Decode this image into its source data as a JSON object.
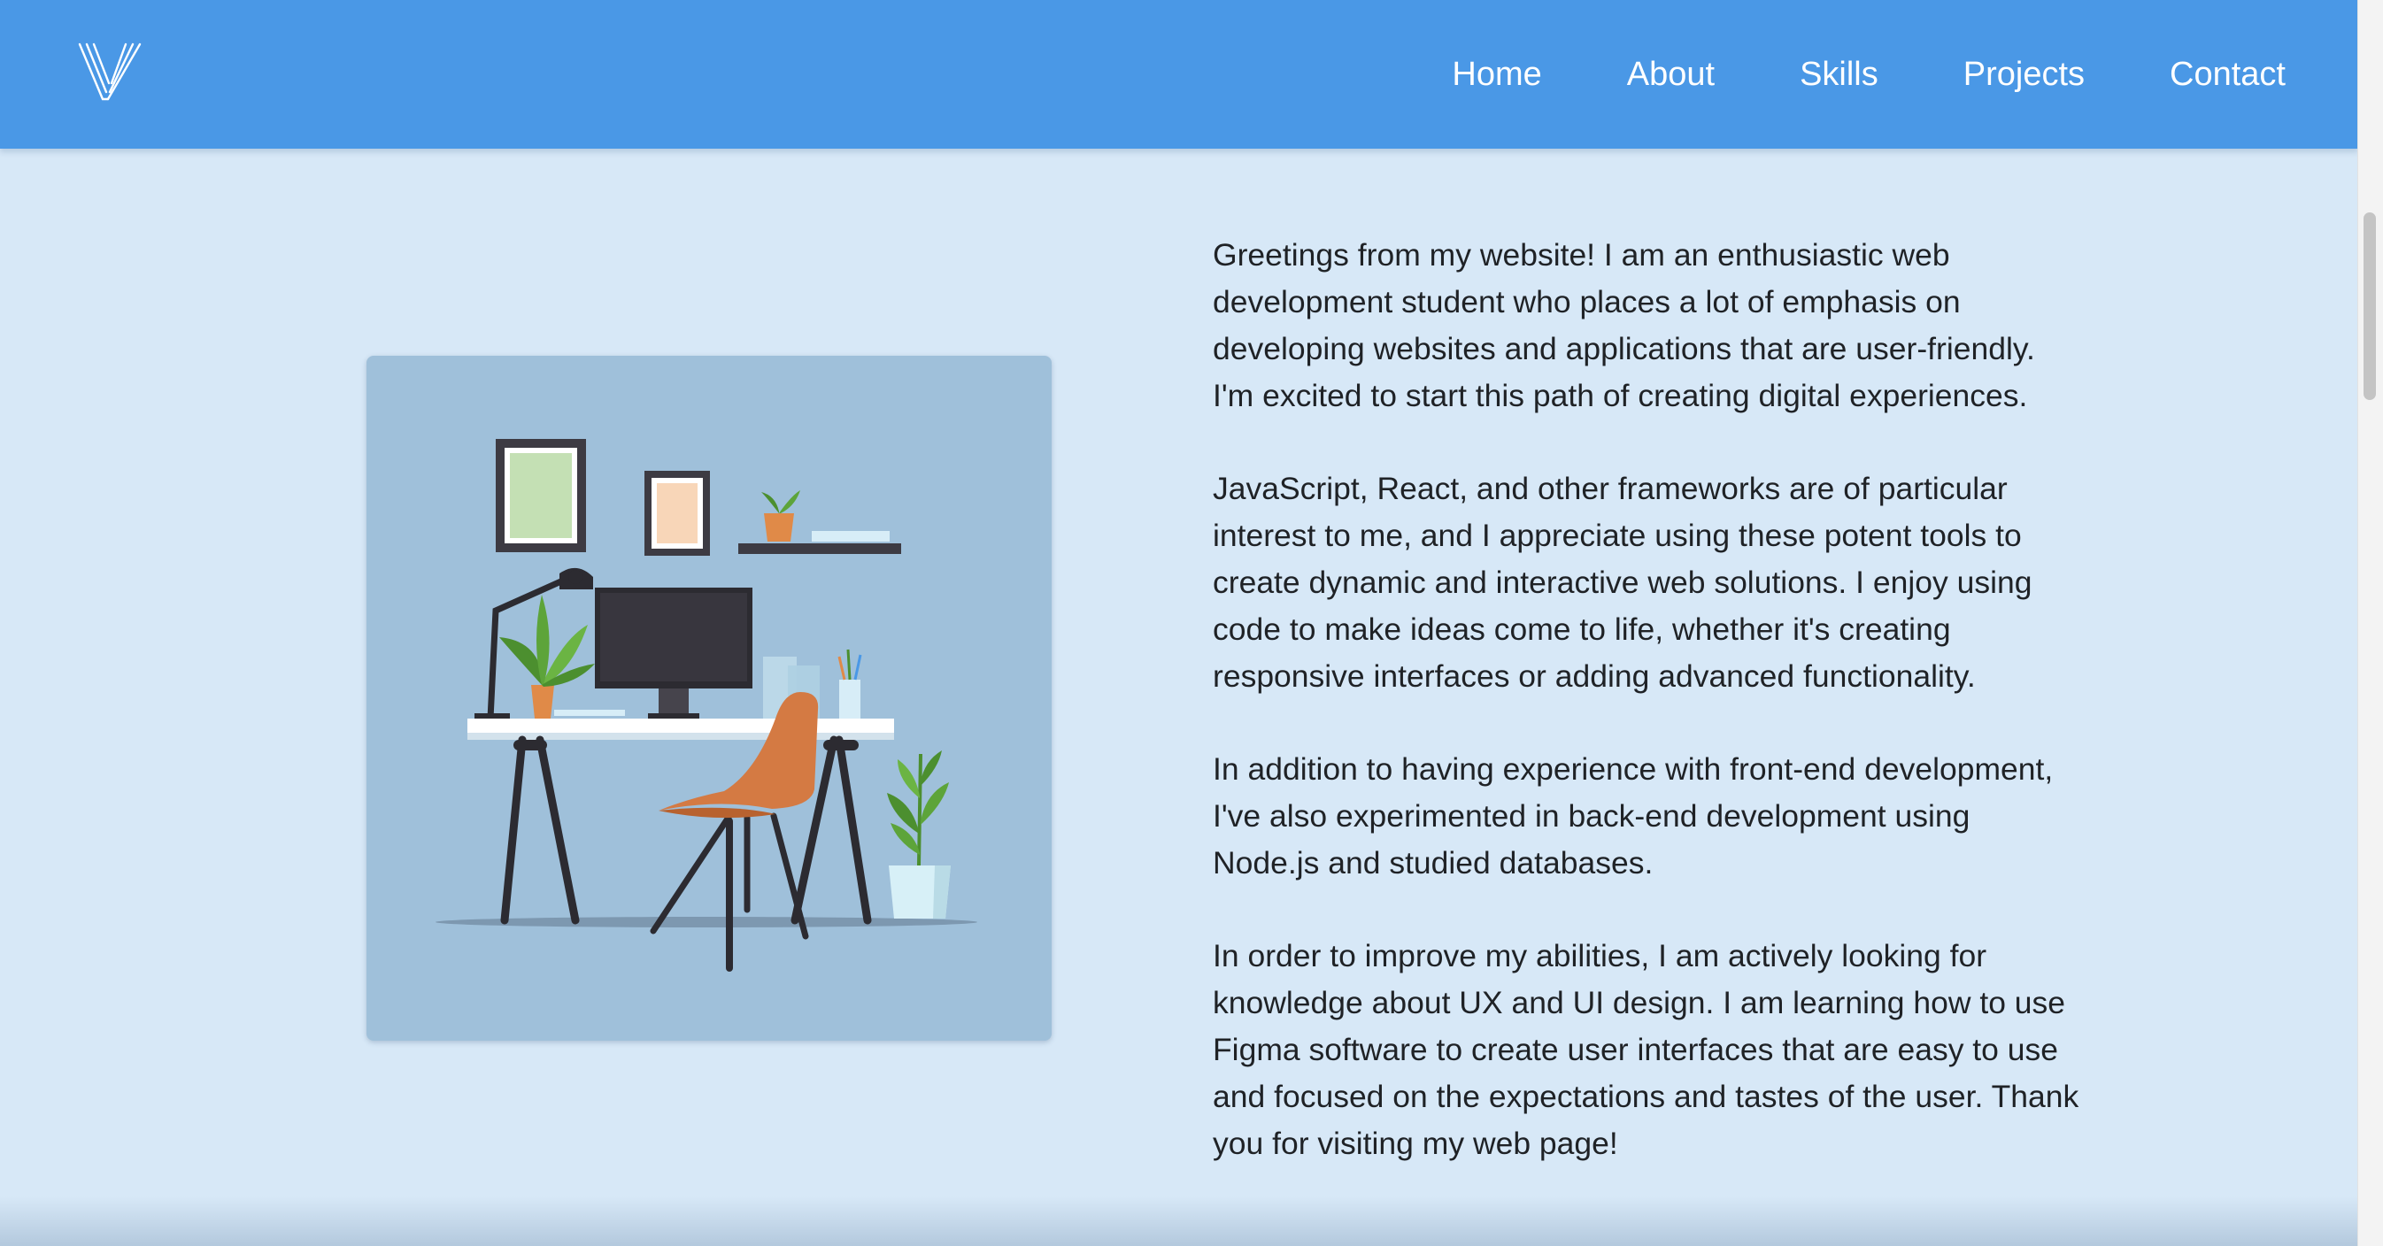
{
  "header": {
    "logo_icon": "stylized-v-logo",
    "brand_color": "#4a98e6",
    "nav": [
      {
        "label": "Home"
      },
      {
        "label": "About"
      },
      {
        "label": "Skills"
      },
      {
        "label": "Projects"
      },
      {
        "label": "Contact"
      }
    ]
  },
  "about": {
    "illustration": "workspace-desk-illustration",
    "paragraphs": [
      "Greetings from my website! I am an enthusiastic web development student who places a lot of emphasis on developing websites and applications that are user-friendly. I'm excited to start this path of creating digital experiences.",
      "JavaScript, React, and other frameworks are of particular interest to me, and I appreciate using these potent tools to create dynamic and interactive web solutions. I enjoy using code to make ideas come to life, whether it's creating responsive interfaces or adding advanced functionality.",
      "In addition to having experience with front-end development, I've also experimented in back-end development using Node.js and studied databases.",
      "In order to improve my abilities, I am actively looking for knowledge about UX and UI design. I am learning how to use Figma software to create user interfaces that are easy to use and focused on the expectations and tastes of the user. Thank you for visiting my web page!"
    ]
  },
  "colors": {
    "page_background": "#d7e8f7",
    "illustration_background": "#9fc0da",
    "text": "#1f2226"
  }
}
